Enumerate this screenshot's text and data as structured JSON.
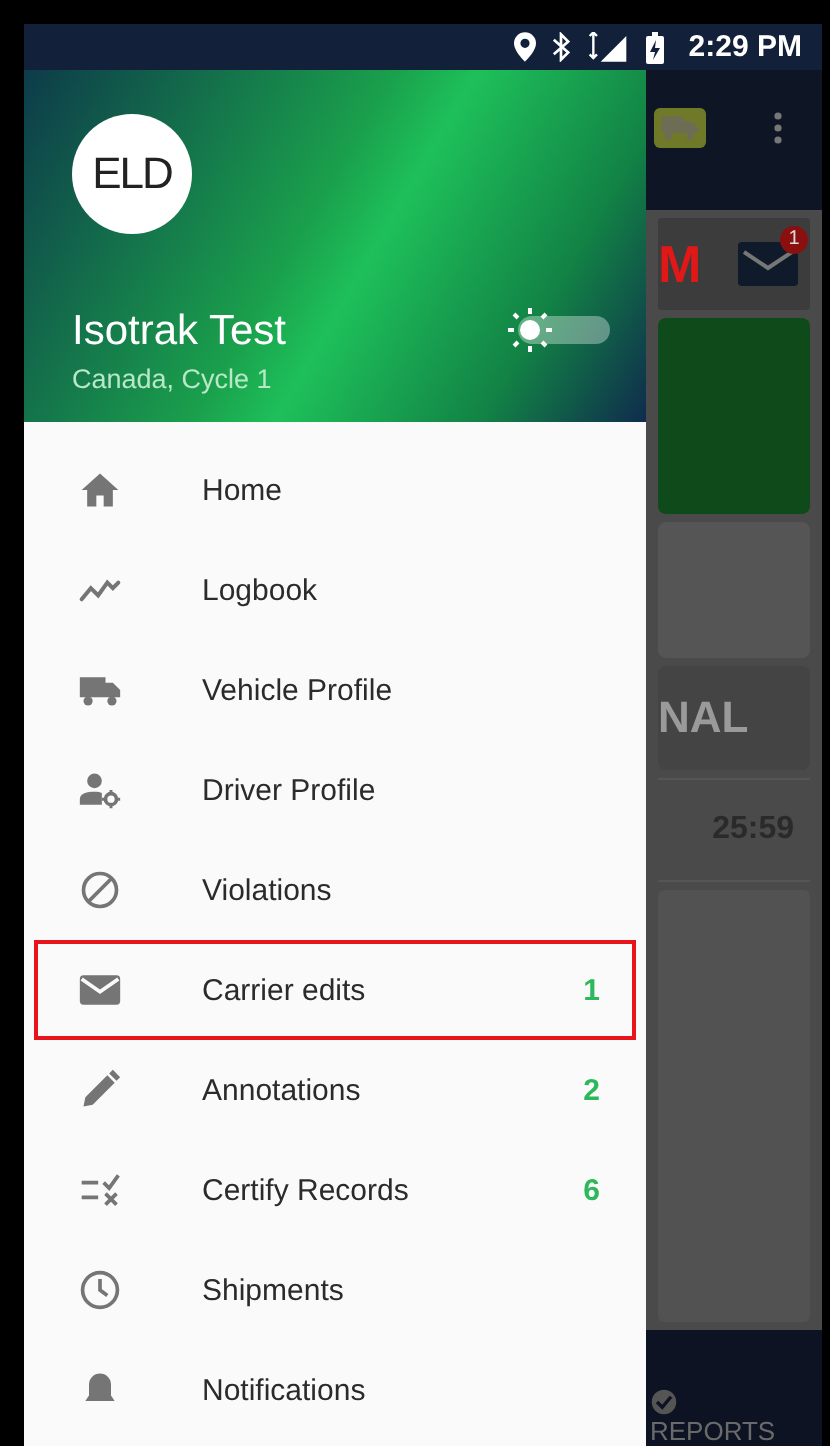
{
  "status_bar": {
    "time": "2:29 PM"
  },
  "drawer": {
    "logo": "ELD",
    "user_name": "Isotrak Test",
    "subtitle": "Canada, Cycle 1",
    "theme_toggle": {
      "on": false
    },
    "items": [
      {
        "label": "Home",
        "selected": false
      },
      {
        "label": "Logbook",
        "selected": false
      },
      {
        "label": "Vehicle Profile",
        "selected": false
      },
      {
        "label": "Driver Profile",
        "selected": false
      },
      {
        "label": "Violations",
        "selected": false
      },
      {
        "label": "Carrier edits",
        "count": "1",
        "selected": true
      },
      {
        "label": "Annotations",
        "count": "2",
        "selected": false
      },
      {
        "label": "Certify Records",
        "count": "6",
        "selected": false
      },
      {
        "label": "Shipments",
        "selected": false
      },
      {
        "label": "Notifications",
        "selected": false
      }
    ]
  },
  "background_screen": {
    "header_text": "M",
    "mail_badge": "1",
    "status_text": "NAL",
    "timer": "25:59",
    "nav_label": "REPORTS"
  }
}
